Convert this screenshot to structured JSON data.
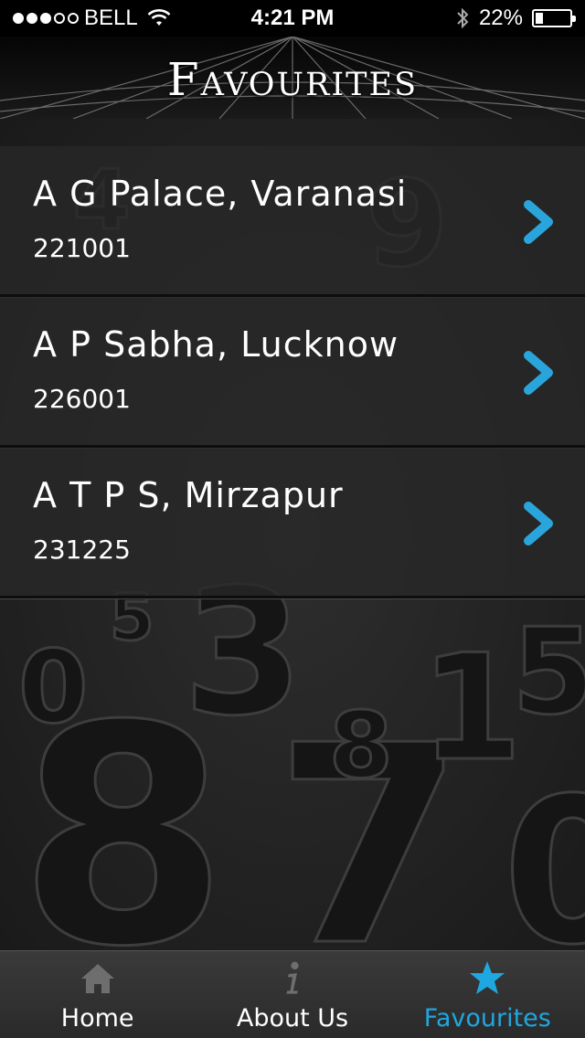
{
  "status_bar": {
    "carrier": "BELL",
    "signal_strength": 3,
    "signal_total": 5,
    "time": "4:21 PM",
    "battery_text": "22%",
    "battery_level": 0.22
  },
  "header": {
    "title": "Favourites"
  },
  "favourites": [
    {
      "name": "A G Palace, Varanasi",
      "pincode": "221001"
    },
    {
      "name": "A P Sabha, Lucknow",
      "pincode": "226001"
    },
    {
      "name": "A T P S, Mirzapur",
      "pincode": "231225"
    }
  ],
  "tabs": [
    {
      "label": "Home",
      "icon": "home-icon",
      "active": false
    },
    {
      "label": "About Us",
      "icon": "info-icon",
      "active": false
    },
    {
      "label": "Favourites",
      "icon": "star-icon",
      "active": true
    }
  ],
  "colors": {
    "accent": "#1fa7e0",
    "chevron": "#2aa5dc"
  }
}
